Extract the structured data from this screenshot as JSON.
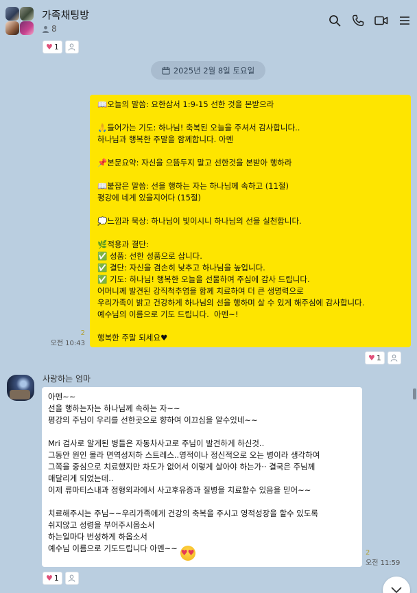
{
  "header": {
    "title": "가족채팅방",
    "member_count": "8",
    "icons": [
      "search-icon",
      "phone-icon",
      "video-call-icon",
      "menu-icon"
    ]
  },
  "date_divider": "2025년 2월 8일 토요일",
  "top_reaction": {
    "like_count": "1"
  },
  "my_message": {
    "text": "📖오늘의 말씀: 요한삼서 1:9-15 선한 것을 본받으라\n\n🙏들어가는 기도: 하나님! 축복된 오늘을 주셔서 감사합니다..\n하나님과 행복한 주말을 함께합니다. 아멘\n\n📌본문요약: 자신을 으뜸두지 말고 선한것을 본받아 행하라\n\n📖붙잡은 말씀: 선을 행하는 자는 하나님께 속하고 (11절)\n평강에 네게 있을지어다 (15절)\n\n💭느낌과 묵상: 하나님이 빛이시니 하나님의 선을 실천합니다.\n\n🌿적용과 결단:\n✅ 성품: 선한 성품으로 삽니다.\n✅ 결단: 자신을 겸손히 낮추고 하나님을 높입니다.\n✅ 기도: 하나님! 행복한 오늘을 선물하여 주심에 감사 드립니다.\n어머니께 발견된 강직척추염을 함께 치료하여 더 큰 생명력으로\n우리가족이 밝고 건강하게 하나님의 선을 행하며 살 수 있게 해주심에 감사합니다.\n예수님의 이름으로 기도 드립니다.  아멘~!\n\n행복한 주말 되세요♥",
    "unread": "2",
    "time": "오전 10:43",
    "like_count": "1"
  },
  "friend_message": {
    "sender": "사랑하는 엄마",
    "text": "아멘~~\n선을 행하는자는 하나님께 속하는 자~~\n평강의 주님이 우리를 선한곳으로 향하여 이끄심을 알수있네~~\n\nMri 검사로 알게된 병들은 자동차사고로 주님이 발견하게 하신것..\n그동안 원인 몰라 면역성저하 스트레스..영적이나 정신적으로 오는 병이라 생각하여\n그쪽을 중심으로 치료했지만 차도가 없어서 이렇게 살아야 하는가·· 결국은 주님께\n매달리게 되었는데..\n이제 류마티스내과 정형외과에서 사고후유증과 질병을 치료할수 있음을 믿어~~\n\n치료해주시는 주님~~우리가족에게 건강의 축복을 주시고 영적성장을 할수 있도록\n쉬지않고 성령을 부어주시옵소서\n하는일마다 번성하게 하옵소서\n예수님 이름으로 기도드립니다 아멘~~",
    "unread": "2",
    "time": "오전 11:59",
    "like_count": "1"
  },
  "colors": {
    "background": "#bacee0",
    "my_bubble": "#fee500",
    "friend_bubble": "#ffffff",
    "heart": "#e0507a"
  }
}
